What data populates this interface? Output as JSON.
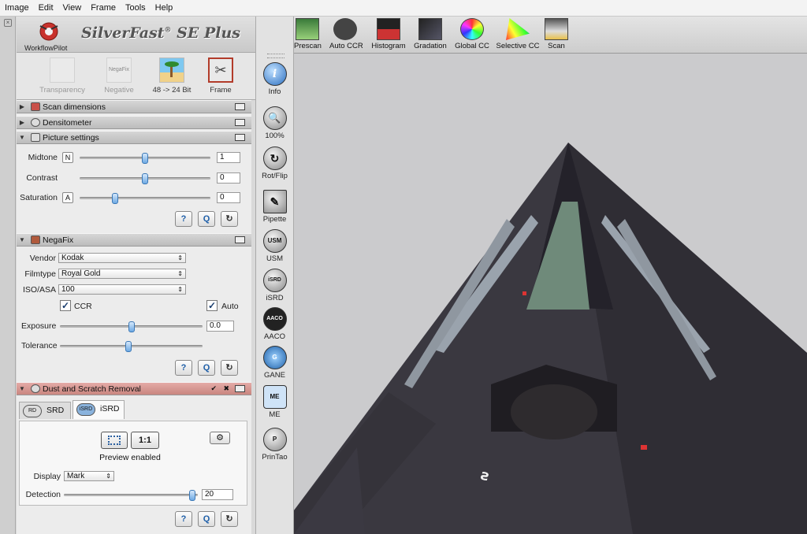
{
  "menu": [
    "Image",
    "Edit",
    "View",
    "Frame",
    "Tools",
    "Help"
  ],
  "app": {
    "title": "SilverFast",
    "reg": "®",
    "edition": "SE Plus",
    "workflow_label": "WorkflowPilot"
  },
  "modes": [
    {
      "label": "Transparency",
      "enabled": false
    },
    {
      "label": "Negative",
      "enabled": false,
      "icon_text": "NegaFix"
    },
    {
      "label": "48 -> 24 Bit",
      "enabled": true
    },
    {
      "label": "Frame",
      "enabled": true,
      "selected": true
    }
  ],
  "sections": {
    "scan_dimensions": "Scan dimensions",
    "densitometer": "Densitometer",
    "picture_settings": "Picture settings",
    "negafix": "NegaFix",
    "dust": "Dust and Scratch Removal"
  },
  "picture": {
    "midtone": {
      "label": "Midtone",
      "btn": "N",
      "value": "1",
      "level": 0.5
    },
    "contrast": {
      "label": "Contrast",
      "value": "0",
      "level": 0.5
    },
    "saturation": {
      "label": "Saturation",
      "btn": "A",
      "value": "0",
      "level": 0.26
    }
  },
  "negafix": {
    "vendor_label": "Vendor",
    "vendor": "Kodak",
    "filmtype_label": "Filmtype",
    "filmtype": "Royal Gold",
    "iso_label": "ISO/ASA",
    "iso": "100",
    "ccr_label": "CCR",
    "auto_label": "Auto",
    "exposure": {
      "label": "Exposure",
      "value": "0.0",
      "level": 0.5
    },
    "tolerance": {
      "label": "Tolerance",
      "level": 0.48
    }
  },
  "dust": {
    "tab_srd": "SRD",
    "tab_srd_icon": "RD",
    "tab_isrd": "iSRD",
    "tab_isrd_icon": "iSRD",
    "zoom_btn": "1:1",
    "preview_text": "Preview enabled",
    "display_label": "Display",
    "display_value": "Mark",
    "detection_label": "Detection",
    "detection_value": "20",
    "detection_level": 0.98
  },
  "footer_buttons": {
    "help": "?",
    "reset": "Q",
    "refresh": "↻"
  },
  "tools": [
    {
      "label": "Info",
      "glyph": "i"
    },
    {
      "label": "100%",
      "glyph": "🔍"
    },
    {
      "label": "Rot/Flip",
      "glyph": "↻"
    },
    {
      "label": "Pipette",
      "glyph": "✎"
    },
    {
      "label": "USM",
      "glyph": "USM"
    },
    {
      "label": "iSRD",
      "glyph": "iSRD"
    },
    {
      "label": "AACO",
      "glyph": "AACO"
    },
    {
      "label": "GANE",
      "glyph": "G"
    },
    {
      "label": "ME",
      "glyph": "ME"
    },
    {
      "label": "PrinTao",
      "glyph": "P"
    }
  ],
  "toolbar": [
    "Prescan",
    "Auto CCR",
    "Histogram",
    "Gradation",
    "Global CC",
    "Selective CC",
    "Scan"
  ],
  "colors": {
    "accent": "#3b78b6",
    "selected": "#b23b2a",
    "dust_header": "#d99a94"
  }
}
